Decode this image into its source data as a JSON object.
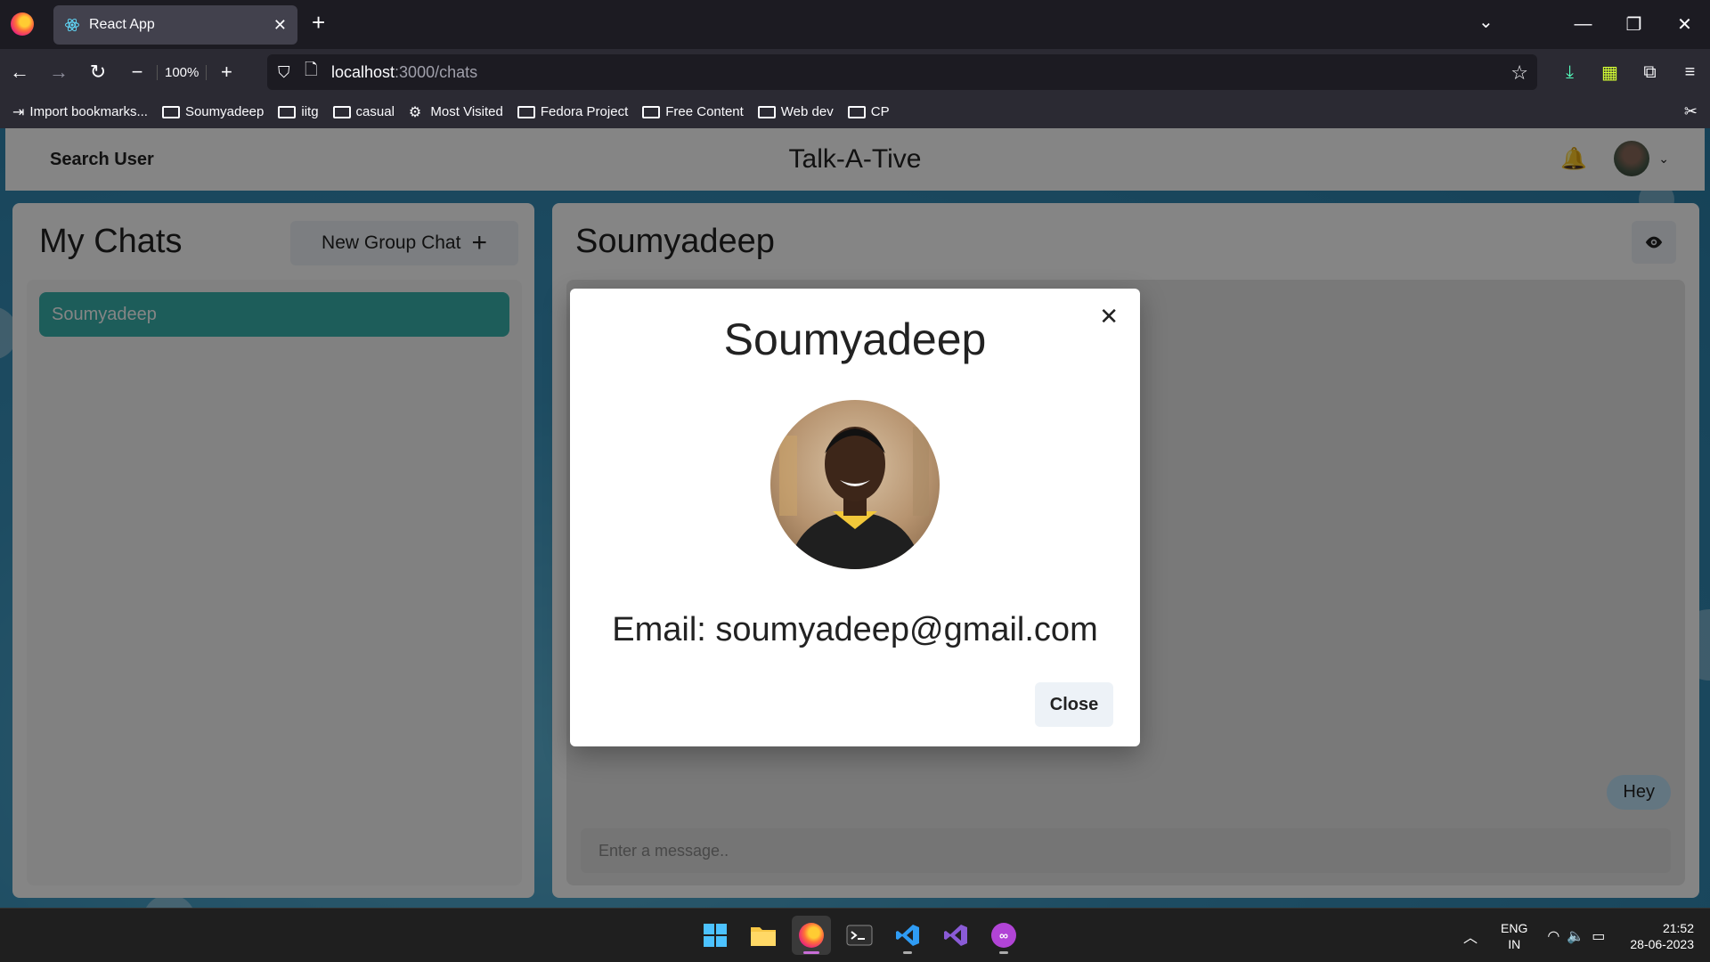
{
  "browser": {
    "tab_title": "React App",
    "url_host": "localhost",
    "url_path": ":3000/chats",
    "zoom": "100%",
    "bookmarks": [
      {
        "label": "Import bookmarks...",
        "icon": "import-icon"
      },
      {
        "label": "Soumyadeep",
        "icon": "folder-icon"
      },
      {
        "label": "iitg",
        "icon": "folder-icon"
      },
      {
        "label": "casual",
        "icon": "folder-icon"
      },
      {
        "label": "Most Visited",
        "icon": "gear-icon"
      },
      {
        "label": "Fedora Project",
        "icon": "folder-icon"
      },
      {
        "label": "Free Content",
        "icon": "folder-icon"
      },
      {
        "label": "Web dev",
        "icon": "folder-icon"
      },
      {
        "label": "CP",
        "icon": "folder-icon"
      }
    ]
  },
  "header": {
    "search_label": "Search User",
    "app_title": "Talk-A-Tive"
  },
  "sidebar": {
    "title": "My Chats",
    "new_group_label": "New Group Chat",
    "chats": [
      {
        "name": "Soumyadeep",
        "selected": true
      }
    ]
  },
  "chat": {
    "title": "Soumyadeep",
    "messages": [
      {
        "text": "Hey",
        "own": true
      }
    ],
    "input_placeholder": "Enter a message.."
  },
  "modal": {
    "title": "Soumyadeep",
    "email_text": "Email: soumyadeep@gmail.com",
    "close_label": "Close"
  },
  "taskbar": {
    "lang_line1": "ENG",
    "lang_line2": "IN",
    "time": "21:52",
    "date": "28-06-2023"
  },
  "colors": {
    "selected_chat": "#38b2ac",
    "message_bubble": "#bee3f8",
    "button_bg": "#edf2f7"
  }
}
